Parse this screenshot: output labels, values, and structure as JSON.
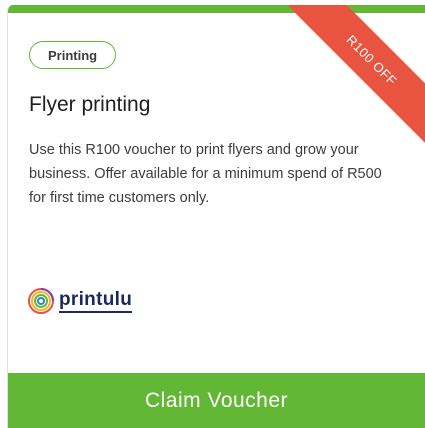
{
  "voucher": {
    "ribbon_text": "R100 OFF",
    "category": "Printing",
    "title": "Flyer printing",
    "description": "Use this R100 voucher to print flyers and grow your business. Offer available for a minimum spend of R500 for first time customers only.",
    "brand": {
      "name": "printulu",
      "logo_icon": "printulu-logo-icon"
    },
    "claim_label": "Claim Voucher"
  },
  "colors": {
    "accent_green": "#62b834",
    "ribbon_red": "#e8543f",
    "brand_navy": "#1b2a5e"
  }
}
